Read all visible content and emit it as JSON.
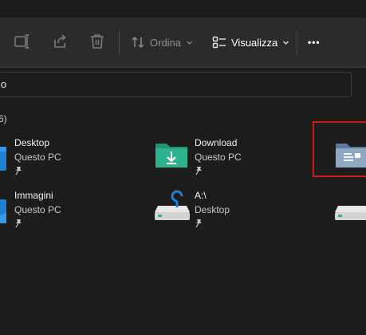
{
  "toolbar": {
    "sort_label": "Ordina",
    "view_label": "Visualizza",
    "more_label": "•••",
    "chevron": "⌄"
  },
  "address_bar": {
    "path_fragment": "lo"
  },
  "quick_access": {
    "group_header": "6)",
    "items": [
      {
        "name": "Desktop",
        "location": "Questo PC",
        "icon": "desktop-folder-icon",
        "pinned": true
      },
      {
        "name": "Download",
        "location": "Questo PC",
        "icon": "download-folder-icon",
        "pinned": true
      },
      {
        "name": "",
        "location": "",
        "icon": "documents-folder-icon",
        "pinned": false
      },
      {
        "name": "Immagini",
        "location": "Questo PC",
        "icon": "pictures-folder-icon",
        "pinned": true
      },
      {
        "name": "A:\\",
        "location": "Desktop",
        "icon": "network-drive-icon",
        "pinned": true
      },
      {
        "name": "",
        "location": "",
        "icon": "drive-icon",
        "pinned": false
      }
    ]
  },
  "colors": {
    "background": "#1c1c1c",
    "toolbar": "#2b2b2b",
    "highlight_box": "#d11919",
    "download_folder": "#2fb38f",
    "blue_folder": "#1e7fd6"
  }
}
